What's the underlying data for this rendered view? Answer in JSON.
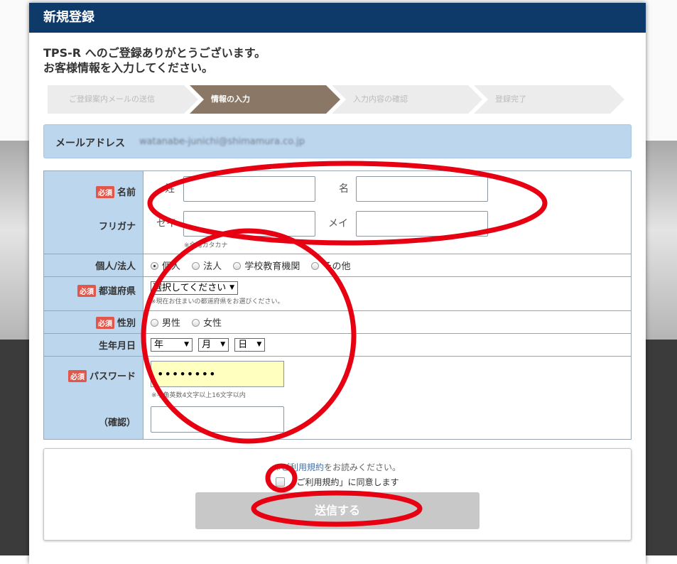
{
  "modal": {
    "title": "新規登録"
  },
  "intro": {
    "line1": "TPS-R へのご登録ありがとうございます。",
    "line2": "お客様情報を入力してください。"
  },
  "steps": [
    {
      "label": "ご登録案内メールの送信",
      "active": false
    },
    {
      "label": "情報の入力",
      "active": true
    },
    {
      "label": "入力内容の確認",
      "active": false
    },
    {
      "label": "登録完了",
      "active": false
    }
  ],
  "email": {
    "label": "メールアドレス",
    "value": "watanabe-junichi@shimamura.co.jp"
  },
  "required_badge": "必須",
  "form": {
    "name": {
      "label": "名前",
      "sei_label": "姓",
      "mei_label": "名",
      "sei_value": "",
      "mei_value": ""
    },
    "furigana": {
      "label": "フリガナ",
      "sei_label": "セイ",
      "mei_label": "メイ",
      "note": "※全角カタカナ"
    },
    "type": {
      "label": "個人/法人",
      "options": [
        "個人",
        "法人",
        "学校教育機関",
        "その他"
      ],
      "selected": "個人"
    },
    "prefecture": {
      "label": "都道府県",
      "selected": "選択してください",
      "note": "※現在お住まいの都道府県をお選びください。"
    },
    "gender": {
      "label": "性別",
      "options": [
        "男性",
        "女性"
      ]
    },
    "birthday": {
      "label": "生年月日",
      "year": "年",
      "month": "月",
      "day": "日"
    },
    "password": {
      "label": "パスワード",
      "value": "••••••••",
      "note": "※半角英数4文字以上16文字以内",
      "confirm_label": "（確認）",
      "confirm_value": ""
    }
  },
  "agreement": {
    "note_prefix": "※",
    "note_link": "ご利用規約",
    "note_suffix": "をお読みください。",
    "checkbox_label": "「ご利用規約」に同意します",
    "submit_label": "送信する"
  },
  "colors": {
    "header": "#0e3a69",
    "label_bg": "#bcd6ee",
    "active_step": "#8b7765",
    "required": "#e2574c",
    "annotation": "#e60012"
  }
}
